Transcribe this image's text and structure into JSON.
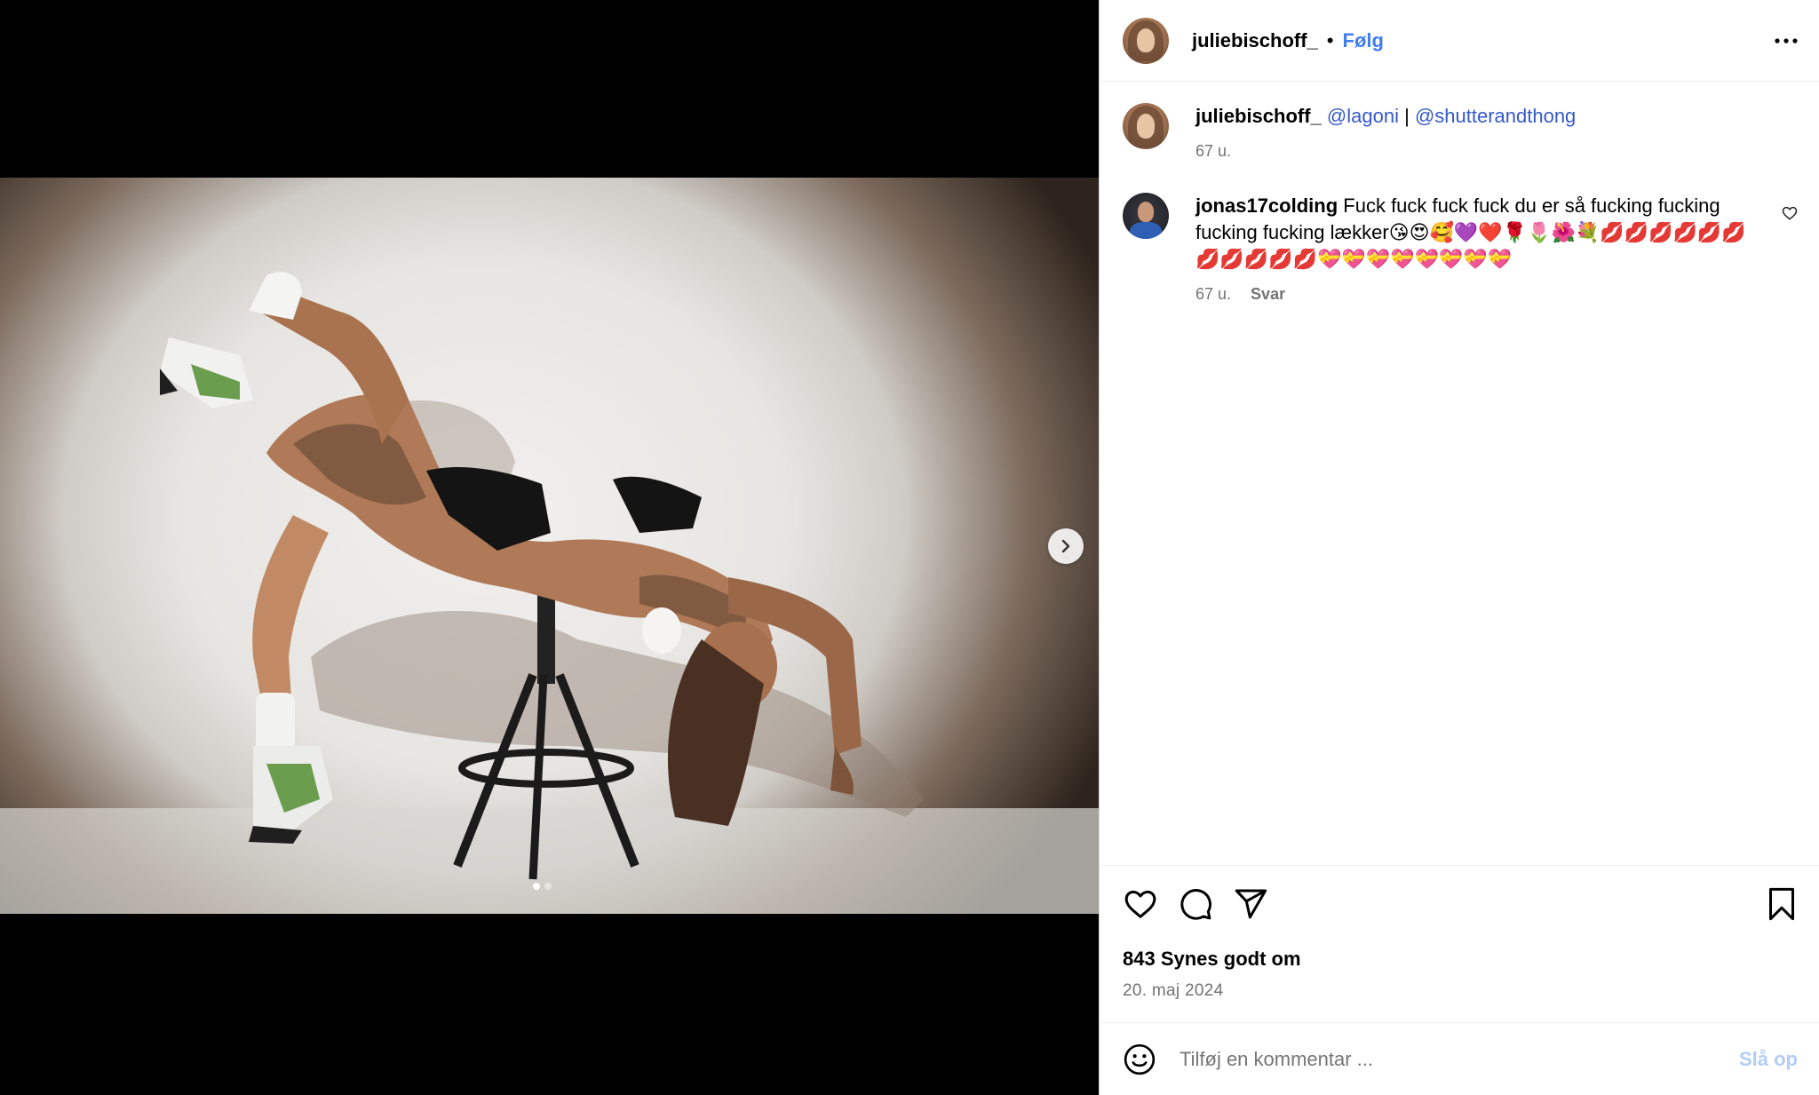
{
  "post": {
    "username": "juliebischoff_",
    "separator": "•",
    "follow_label": "Følg",
    "more_icon": "more-horizontal-icon",
    "media": {
      "next_icon": "chevron-right-icon",
      "slide_count": 2,
      "active_slide": 1
    }
  },
  "caption": {
    "username": "juliebischoff_",
    "mention_1": "@lagoni",
    "divider": " | ",
    "mention_2": "@shutterandthong",
    "time": "67 u."
  },
  "comments": [
    {
      "username": "jonas17colding",
      "text": "Fuck fuck fuck fuck du er så fucking fucking fucking fucking lækker😘😍🥰💜❤️🌹🌷🌺💐💋💋💋💋💋💋💋💋💋💋💋💝💝💝💝💝💝💝💝",
      "time": "67 u.",
      "reply_label": "Svar",
      "like_icon": "heart-outline-icon"
    }
  ],
  "actions": {
    "like_icon": "heart-icon",
    "comment_icon": "comment-icon",
    "share_icon": "send-icon",
    "save_icon": "bookmark-icon",
    "likes_text": "843 Synes godt om",
    "date": "20. maj 2024"
  },
  "composer": {
    "emoji_icon": "smiley-icon",
    "placeholder": "Tilføj en kommentar ...",
    "post_label": "Slå op"
  },
  "colors": {
    "link_blue": "#3f7ef0",
    "mention_blue": "#3559c7",
    "muted_text": "#737373",
    "post_disabled": "#b3cdf7",
    "divider": "#efefef"
  }
}
